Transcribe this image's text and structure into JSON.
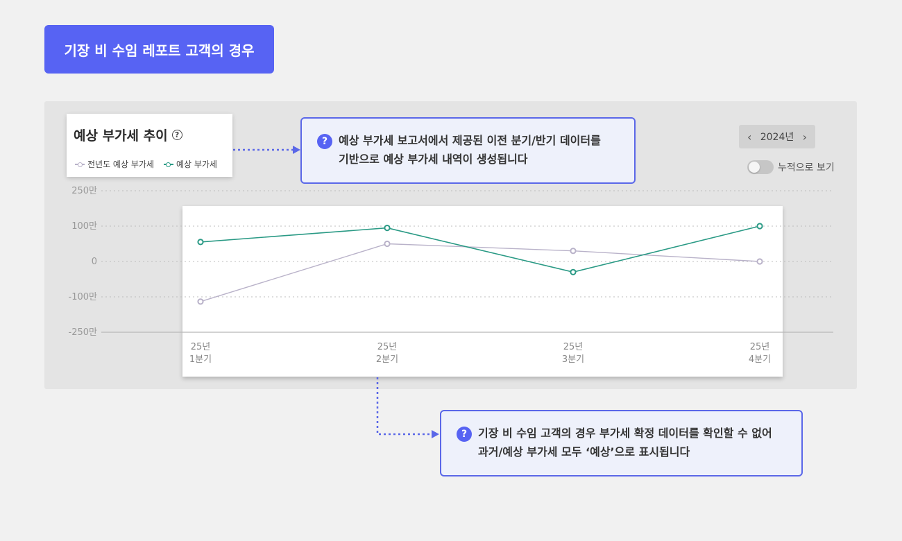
{
  "title_badge": "기장 비 수임 레포트 고객의 경우",
  "card": {
    "title": "예상 부가세 추이",
    "help_glyph": "?",
    "legend": [
      {
        "label": "전년도 예상 부가세",
        "color": "#b9b2c9"
      },
      {
        "label": "예상 부가세",
        "color": "#2a9a85"
      }
    ]
  },
  "callout_top": {
    "line1": "예상 부가세 보고서에서 제공된 이전 분기/반기 데이터를",
    "line2": "기반으로 예상 부가세 내역이 생성됩니다"
  },
  "callout_bottom": {
    "line1": "기장 비 수임 고객의 경우 부가세 확정 데이터를 확인할 수 없어",
    "line2": "과거/예상 부가세 모두 ‘예상’으로 표시됩니다"
  },
  "year_nav": {
    "prev": "‹",
    "label": "2024년",
    "next": "›"
  },
  "toggle_label": "누적으로 보기",
  "colors": {
    "accent": "#5763f3",
    "prev_series": "#b9b2c9",
    "curr_series": "#2a9a85"
  },
  "chart_data": {
    "type": "line",
    "y_ticks": [
      "250만",
      "100만",
      "0",
      "-100만",
      "-250만"
    ],
    "categories": [
      [
        "25년",
        "1분기"
      ],
      [
        "25년",
        "2분기"
      ],
      [
        "25년",
        "3분기"
      ],
      [
        "25년",
        "4분기"
      ]
    ],
    "series": [
      {
        "name": "전년도 예상 부가세",
        "values": [
          -120,
          50,
          30,
          0
        ]
      },
      {
        "name": "예상 부가세",
        "values": [
          55,
          95,
          -30,
          100
        ]
      }
    ]
  }
}
